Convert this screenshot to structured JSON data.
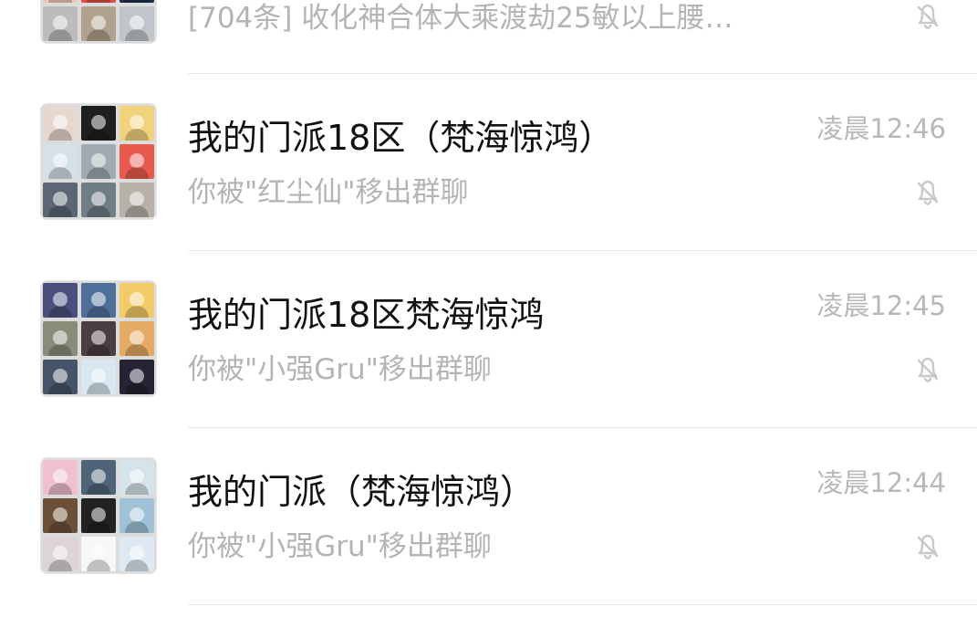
{
  "chat_list": [
    {
      "title": "",
      "preview": "[704条] 收化神合体大乘渡劫25敏以上腰…",
      "time": "",
      "muted": true,
      "avatar_colors": [
        "#efe4de",
        "#d7a17d",
        "#3b3b3b",
        "#edc7bb",
        "#df4d40",
        "#1d2f47",
        "#bcbcbc",
        "#b0a28e",
        "#c0c5c9"
      ]
    },
    {
      "title": "我的门派18区（梵海惊鸿）",
      "preview": "你被\"红尘仙\"移出群聊",
      "time": "凌晨12:46",
      "muted": true,
      "avatar_colors": [
        "#e7d8cf",
        "#1f1f1f",
        "#f2d37d",
        "#d6e0e8",
        "#9faab2",
        "#e85a4d",
        "#5c6674",
        "#6f7d84",
        "#b8b1a9"
      ]
    },
    {
      "title": "我的门派18区梵海惊鸿",
      "preview": "你被\"小强Gru\"移出群聊",
      "time": "凌晨12:45",
      "muted": true,
      "avatar_colors": [
        "#4b4f7c",
        "#4f6f9b",
        "#f3cc69",
        "#8a8b79",
        "#4a3d44",
        "#e5aa63",
        "#455468",
        "#d8e7f0",
        "#252435"
      ]
    },
    {
      "title": "我的门派（梵海惊鸿）",
      "preview": "你被\"小强Gru\"移出群聊",
      "time": "凌晨12:44",
      "muted": true,
      "avatar_colors": [
        "#f0bfd0",
        "#4f6479",
        "#d5e4ea",
        "#6c5038",
        "#212121",
        "#9fc2d7",
        "#ddd4d5",
        "#f7f7f7",
        "#dfe9f4"
      ]
    }
  ]
}
